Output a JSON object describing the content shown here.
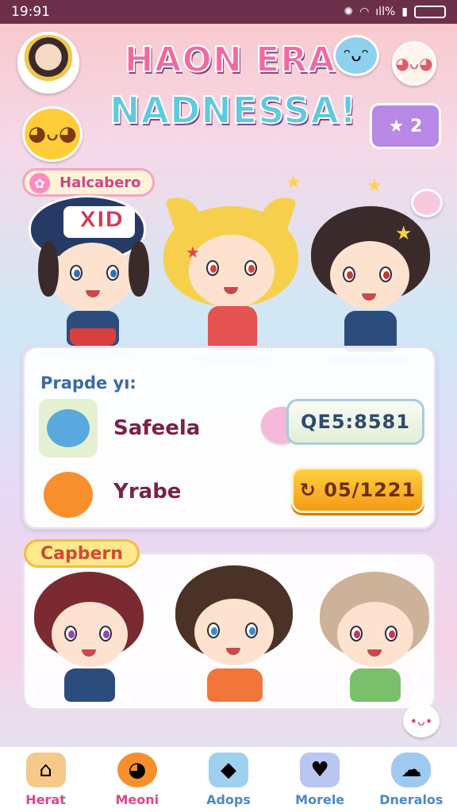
{
  "status_bar": {
    "time": "19:91",
    "signal": "ıll%"
  },
  "header": {
    "title_line1": "HAON ERA",
    "title_line2": "NADNESSA!",
    "badge_text": "★ 2",
    "colors": {
      "line1": "#f06aa0",
      "line2": "#5fc9e0"
    }
  },
  "section_tag": "Halcabero",
  "characters_top": [
    {
      "name": "cap-kid",
      "cap_text": "XID",
      "hair": "#3a2a2a"
    },
    {
      "name": "cat-girl",
      "hair": "#f6d04c"
    },
    {
      "name": "dark-hair-girl",
      "hair": "#3a2a2a"
    }
  ],
  "panel": {
    "title": "Prapde yı:",
    "rows": [
      {
        "name": "Safeela",
        "value": "QE5:8581",
        "icon": "blue-creature-icon"
      },
      {
        "name": "Yrabe",
        "value": "↻ 05/1221",
        "icon": "orange-creature-icon"
      }
    ]
  },
  "capbern": {
    "label": "Capbern"
  },
  "nav": {
    "items": [
      {
        "label": "Herat",
        "icon": "house-icon",
        "color": "#e2458a"
      },
      {
        "label": "Meoni",
        "icon": "pet-icon",
        "color": "#e2458a"
      },
      {
        "label": "Adops",
        "icon": "gem-icon",
        "color": "#4a8ac4"
      },
      {
        "label": "Morele",
        "icon": "heart-icon",
        "color": "#4a8ac4"
      },
      {
        "label": "Dneralos",
        "icon": "cloud-icon",
        "color": "#4a8ac4"
      }
    ]
  }
}
